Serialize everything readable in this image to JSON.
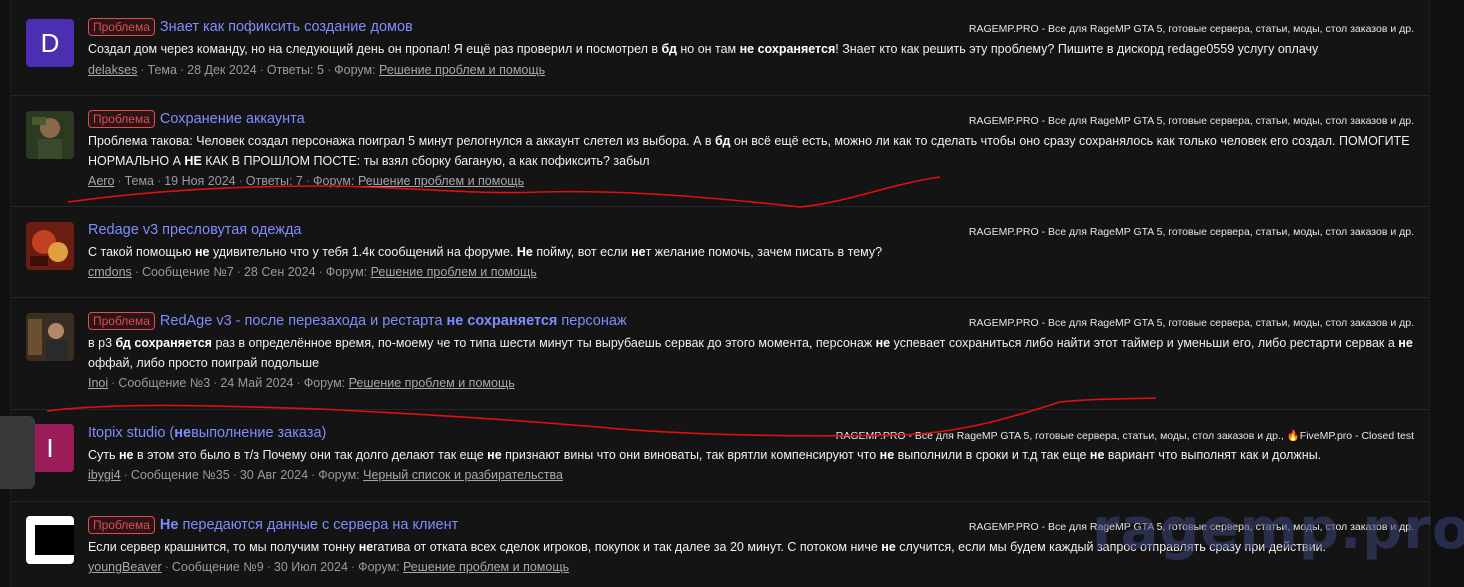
{
  "results": [
    {
      "avatar_letter": "D",
      "avatar_color": "#4b2fb0",
      "badge": "Проблема",
      "title_parts": [
        {
          "t": "Знает как пофиксить создание домов",
          "b": false
        }
      ],
      "source": "RAGEMP.PRO - Все для RageMP GTA 5, готовые сервера, статьи, моды, стол заказов и др.",
      "snippet_parts": [
        {
          "t": "Создал дом через команду, но на следующий день он пропал! Я ещё раз проверил и посмотрел в ",
          "b": false
        },
        {
          "t": "бд",
          "b": true
        },
        {
          "t": " но он там ",
          "b": false
        },
        {
          "t": "не сохраняется",
          "b": true
        },
        {
          "t": "! Знает кто как решить эту проблему? Пишите в дискорд redage0559 услугу оплачу",
          "b": false
        }
      ],
      "author": "delakses",
      "type": "Тема",
      "date": "28 Дек 2024",
      "extra": "Ответы: 5",
      "forum_label": "Форум:",
      "forum": "Решение проблем и помощь"
    },
    {
      "avatar_letter": "",
      "avatar_color": "#3d4a2a",
      "badge": "Проблема",
      "title_parts": [
        {
          "t": "Сохранение аккаунта",
          "b": false
        }
      ],
      "source": "RAGEMP.PRO - Все для RageMP GTA 5, готовые сервера, статьи, моды, стол заказов и др.",
      "snippet_parts": [
        {
          "t": "Проблема такова: Человек создал персонажа поиграл 5 минут релогнулся а аккаунт слетел из выбора. А в ",
          "b": false
        },
        {
          "t": "бд",
          "b": true
        },
        {
          "t": " он всё ещё есть, можно ли как то сделать чтобы оно сразу сохранялось как только человек его создал. ПОМОГИТЕ НОРМАЛЬНО А ",
          "b": false
        },
        {
          "t": "НЕ",
          "b": true
        },
        {
          "t": " КАК В ПРОШЛОМ ПОСТЕ: ты взял сборку баганую, а как пофиксить? забыл",
          "b": false
        }
      ],
      "author": "Aero",
      "type": "Тема",
      "date": "19 Ноя 2024",
      "extra": "Ответы: 7",
      "forum_label": "Форум:",
      "forum": "Решение проблем и помощь"
    },
    {
      "avatar_letter": "",
      "avatar_color": "#7a2a1a",
      "badge": "",
      "title_parts": [
        {
          "t": "Redage v3 пресловутая одежда",
          "b": false
        }
      ],
      "source": "RAGEMP.PRO - Все для RageMP GTA 5, готовые сервера, статьи, моды, стол заказов и др.",
      "snippet_parts": [
        {
          "t": "С такой помощью ",
          "b": false
        },
        {
          "t": "не",
          "b": true
        },
        {
          "t": " удивительно что у тебя 1.4к сообщений на форуме. ",
          "b": false
        },
        {
          "t": "Не",
          "b": true
        },
        {
          "t": " пойму, вот если ",
          "b": false
        },
        {
          "t": "не",
          "b": true
        },
        {
          "t": "т желание помочь, зачем писать в тему?",
          "b": false
        }
      ],
      "author": "cmdons",
      "type": "Сообщение №7",
      "date": "28 Сен 2024",
      "extra": "",
      "forum_label": "Форум:",
      "forum": "Решение проблем и помощь"
    },
    {
      "avatar_letter": "",
      "avatar_color": "#4a3a2a",
      "badge": "Проблема",
      "title_parts": [
        {
          "t": "RedAge v3 - после перезахода и рестарта ",
          "b": false
        },
        {
          "t": "не сохраняется",
          "b": true
        },
        {
          "t": " персонаж",
          "b": false
        }
      ],
      "source": "RAGEMP.PRO - Все для RageMP GTA 5, готовые сервера, статьи, моды, стол заказов и др.",
      "snippet_parts": [
        {
          "t": "в р3 ",
          "b": false
        },
        {
          "t": "бд сохраняется",
          "b": true
        },
        {
          "t": " раз в определённое время, по-моему че то типа шести минут ты вырубаешь сервак до этого момента, персонаж ",
          "b": false
        },
        {
          "t": "не",
          "b": true
        },
        {
          "t": " успевает сохраниться либо найти этот таймер и уменьши его, либо рестарти сервак а ",
          "b": false
        },
        {
          "t": "не",
          "b": true
        },
        {
          "t": " оффай, либо просто поиграй подольше",
          "b": false
        }
      ],
      "author": "Inoi",
      "type": "Сообщение №3",
      "date": "24 Май 2024",
      "extra": "",
      "forum_label": "Форум:",
      "forum": "Решение проблем и помощь"
    },
    {
      "avatar_letter": "I",
      "avatar_color": "#9a1d5a",
      "badge": "",
      "title_parts": [
        {
          "t": "Itopix studio (",
          "b": false
        },
        {
          "t": "не",
          "b": true
        },
        {
          "t": "выполнение заказа)",
          "b": false
        }
      ],
      "source": "RAGEMP.PRO - Все для RageMP GTA 5, готовые сервера, статьи, моды, стол заказов и др., 🔥FiveMP.pro - Closed test",
      "snippet_parts": [
        {
          "t": "Суть ",
          "b": false
        },
        {
          "t": "не",
          "b": true
        },
        {
          "t": " в этом это было в т/з Почему они так долго делают так еще ",
          "b": false
        },
        {
          "t": "не",
          "b": true
        },
        {
          "t": " признают вины что они виноваты, так врятли компенсируют что ",
          "b": false
        },
        {
          "t": "не",
          "b": true
        },
        {
          "t": " выполнили в сроки и т.д так еще ",
          "b": false
        },
        {
          "t": "не",
          "b": true
        },
        {
          "t": " вариант что выполнят как и должны.",
          "b": false
        }
      ],
      "author": "ibygi4",
      "type": "Сообщение №35",
      "date": "30 Авг 2024",
      "extra": "",
      "forum_label": "Форум:",
      "forum": "Черный список и разбирательства"
    },
    {
      "avatar_letter": "",
      "avatar_color": "#ffffff",
      "badge": "Проблема",
      "title_parts": [
        {
          "t": "Не",
          "b": true
        },
        {
          "t": " передаются данные с сервера на клиент",
          "b": false
        }
      ],
      "source": "RAGEMP.PRO - Все для RageMP GTA 5, готовые сервера, статьи, моды, стол заказов и др.",
      "snippet_parts": [
        {
          "t": "Если сервер крашнится, то мы получим тонну ",
          "b": false
        },
        {
          "t": "не",
          "b": true
        },
        {
          "t": "гатива от отката всех сделок игроков, покупок и так далее за 20 минут. С потоком ниче ",
          "b": false
        },
        {
          "t": "не",
          "b": true
        },
        {
          "t": " случится, если мы будем каждый запрос отправлять сразу при действии.",
          "b": false
        }
      ],
      "author": "youngBeaver",
      "type": "Сообщение №9",
      "date": "30 Июл 2024",
      "extra": "",
      "forum_label": "Форум:",
      "forum": "Решение проблем и помощь"
    }
  ],
  "watermark": "ragemp.pro",
  "colors": {
    "link": "#7f8cff",
    "badge": "#e24a52",
    "annotation": "#e01010"
  }
}
